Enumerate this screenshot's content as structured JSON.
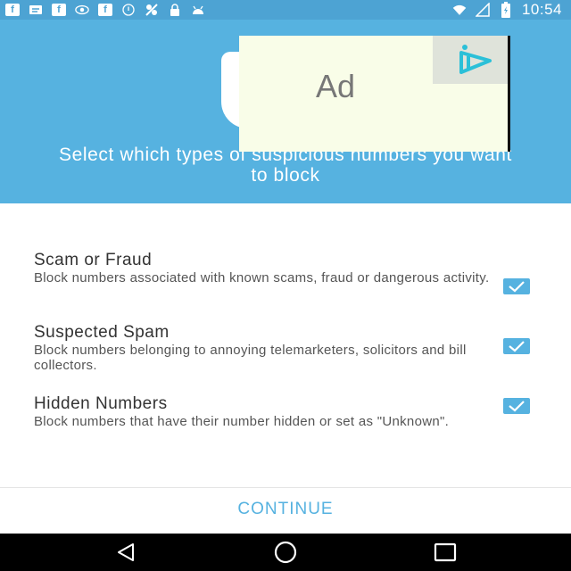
{
  "status_bar": {
    "time": "10:54",
    "left_icons": [
      "facebook-icon",
      "message-icon",
      "facebook-icon",
      "eye-icon",
      "facebook-icon",
      "alarm-icon",
      "no-signal-icon",
      "lock-icon",
      "android-icon"
    ],
    "right_icons": [
      "wifi-icon",
      "signal-icon",
      "battery-icon"
    ]
  },
  "header": {
    "title": "Select which types of suspicious numbers you want to block",
    "background": "#56b2e0"
  },
  "ad": {
    "label": "Ad",
    "choices_icon": "ad-choices-icon"
  },
  "options": [
    {
      "title": "Scam or Fraud",
      "description": "Block numbers associated with known scams, fraud or dangerous activity.",
      "checked": true
    },
    {
      "title": "Suspected Spam",
      "description": "Block numbers belonging to annoying telemarketers, solicitors and bill collectors.",
      "checked": true
    },
    {
      "title": "Hidden Numbers",
      "description": "Block numbers that have their number hidden or set as \"Unknown\".",
      "checked": true
    }
  ],
  "continue_label": "CONTINUE",
  "nav": {
    "back": "back-icon",
    "home": "home-icon",
    "recents": "recents-icon"
  },
  "colors": {
    "accent": "#56b2e0",
    "status_bar": "#4da3d3"
  }
}
